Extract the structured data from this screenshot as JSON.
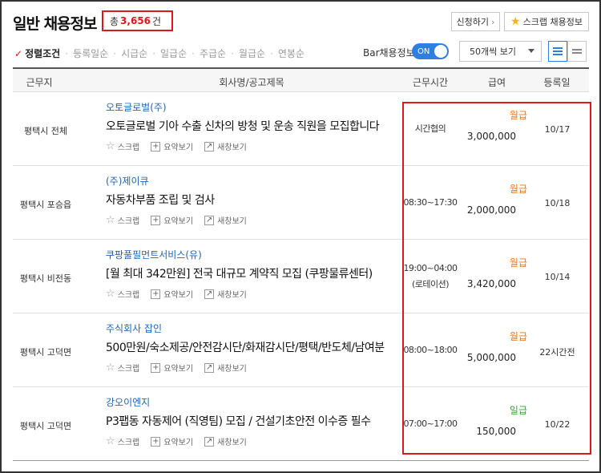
{
  "header": {
    "title": "일반 채용정보",
    "count_prefix": "총",
    "count_value": "3,656",
    "count_suffix": "건",
    "apply_label": "신청하기",
    "apply_arrow": "›",
    "scrap_label": "스크랩 채용정보"
  },
  "sort": {
    "check": "✓",
    "items": [
      "정렬조건",
      "등록일순",
      "시급순",
      "일급순",
      "주급순",
      "월급순",
      "연봉순"
    ],
    "separator": "·"
  },
  "bar_toggle": {
    "label": "Bar채용정보",
    "state": "ON"
  },
  "page_size": {
    "selected": "50개씩 보기"
  },
  "table": {
    "columns": [
      "근무지",
      "회사명/공고제목",
      "근무시간",
      "급여",
      "등록일"
    ],
    "scrap_label": "스크랩",
    "summary_label": "요약보기",
    "newwin_label": "새창보기",
    "rows": [
      {
        "location": "평택시 전체",
        "company": "오토글로벌(주)",
        "title": "오토글로벌 기아 수출 신차의 방청 및 운송 직원을 모집합니다",
        "time1": "시간협의",
        "time2": "",
        "pay_type": "월급",
        "pay_color": "#e8741c",
        "amount": "3,000,000",
        "date": "10/17"
      },
      {
        "location": "평택시 포승읍",
        "company": "(주)제이큐",
        "title": "자동차부품 조립 및 검사",
        "time1": "08:30~17:30",
        "time2": "",
        "pay_type": "월급",
        "pay_color": "#e8741c",
        "amount": "2,000,000",
        "date": "10/18"
      },
      {
        "location": "평택시 비전동",
        "company": "쿠팡풀필먼트서비스(유)",
        "title": "[월 최대 342만원] 전국 대규모 계약직 모집 (쿠팡물류센터)",
        "time1": "19:00~04:00",
        "time2": "(로테이션)",
        "pay_type": "월급",
        "pay_color": "#e8741c",
        "amount": "3,420,000",
        "date": "10/14"
      },
      {
        "location": "평택시 고덕면",
        "company": "주식회사 잡인",
        "title": "500만원/숙소제공/안전감시단/화재감시단/평택/반도체/남여분",
        "time1": "08:00~18:00",
        "time2": "",
        "pay_type": "월급",
        "pay_color": "#e8741c",
        "amount": "5,000,000",
        "date": "22시간전"
      },
      {
        "location": "평택시 고덕면",
        "company": "강오이엔지",
        "title": "P3팹동 자동제어 (직영팀) 모집 / 건설기초안전 이수증 필수",
        "time1": "07:00~17:00",
        "time2": "",
        "pay_type": "일급",
        "pay_color": "#3aa13a",
        "amount": "150,000",
        "date": "10/22"
      }
    ]
  },
  "colors": {
    "accent_red": "#e0161e",
    "link_blue": "#2265b8",
    "toggle_blue": "#2f7fe0"
  },
  "icons": [
    "star-icon",
    "plus-box-icon",
    "new-window-icon",
    "list-view-icon",
    "card-view-icon",
    "chevron-down-icon"
  ]
}
